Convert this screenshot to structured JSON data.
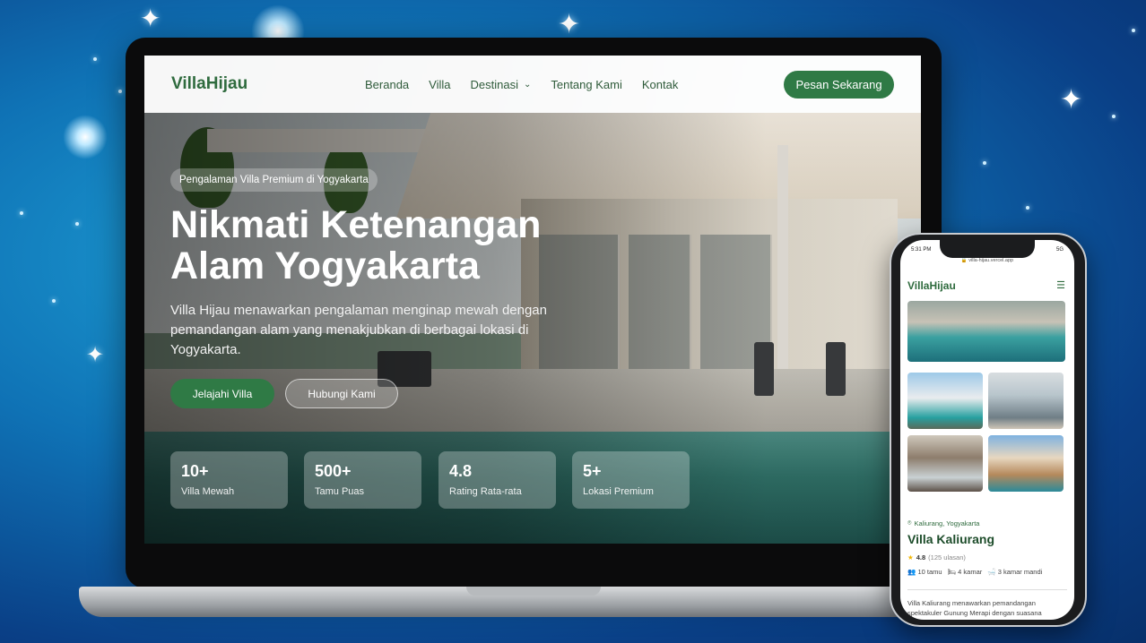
{
  "desktop": {
    "brand": "VillaHijau",
    "nav": {
      "items": [
        "Beranda",
        "Villa",
        "Destinasi",
        "Tentang Kami",
        "Kontak"
      ],
      "cta": "Pesan Sekarang"
    },
    "hero": {
      "badge": "Pengalaman Villa Premium di Yogyakarta",
      "title_line1": "Nikmati Ketenangan",
      "title_line2": "Alam Yogyakarta",
      "description": "Villa Hijau menawarkan pengalaman menginap mewah dengan pemandangan alam yang menakjubkan di berbagai lokasi di Yogyakarta.",
      "primary_button": "Jelajahi Villa",
      "secondary_button": "Hubungi Kami"
    },
    "stats": [
      {
        "value": "10+",
        "label": "Villa Mewah"
      },
      {
        "value": "500+",
        "label": "Tamu Puas"
      },
      {
        "value": "4.8",
        "label": "Rating Rata-rata"
      },
      {
        "value": "5+",
        "label": "Lokasi Premium"
      }
    ]
  },
  "mobile": {
    "time": "5:31 PM",
    "network": "5G",
    "url": "villa-hijau.vercel.app",
    "brand": "VillaHijau",
    "location": "Kaliurang, Yogyakarta",
    "title": "Villa Kaliurang",
    "rating": "4.8",
    "reviews": "(125 ulasan)",
    "features": [
      "10 tamu",
      "4 kamar",
      "3 kamar mandi"
    ],
    "description": "Villa Kaliurang menawarkan pemandangan spektakuler Gunung Merapi dengan suasana"
  },
  "colors": {
    "brand_green": "#2f7a45",
    "background_blue": "#0f72b5"
  }
}
